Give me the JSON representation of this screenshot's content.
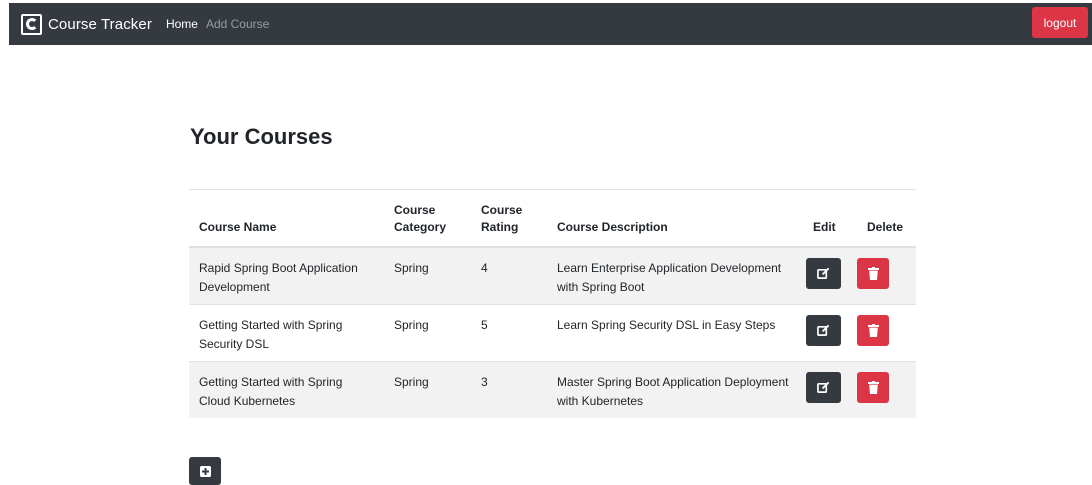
{
  "navbar": {
    "brand": "Course Tracker",
    "links": [
      {
        "label": "Home",
        "active": true
      },
      {
        "label": "Add Course",
        "active": false
      }
    ],
    "logout_label": "logout"
  },
  "page": {
    "title": "Your Courses"
  },
  "table": {
    "headers": {
      "name": "Course Name",
      "category_line1": "Course",
      "category_line2": "Category",
      "rating_line1": "Course",
      "rating_line2": "Rating",
      "description": "Course Description",
      "edit": "Edit",
      "delete": "Delete"
    },
    "rows": [
      {
        "name": "Rapid Spring Boot Application Development",
        "category": "Spring",
        "rating": "4",
        "description": "Learn Enterprise Application Development with Spring Boot"
      },
      {
        "name": "Getting Started with Spring Security DSL",
        "category": "Spring",
        "rating": "5",
        "description": "Learn Spring Security DSL in Easy Steps"
      },
      {
        "name": "Getting Started with Spring Cloud Kubernetes",
        "category": "Spring",
        "rating": "3",
        "description": "Master Spring Boot Application Deployment with Kubernetes"
      }
    ]
  },
  "icons": {
    "edit": "edit-icon",
    "delete": "trash-icon",
    "add": "plus-square-icon"
  },
  "colors": {
    "navbar": "#343a40",
    "danger": "#dc3545",
    "dark_button": "#343a40"
  }
}
